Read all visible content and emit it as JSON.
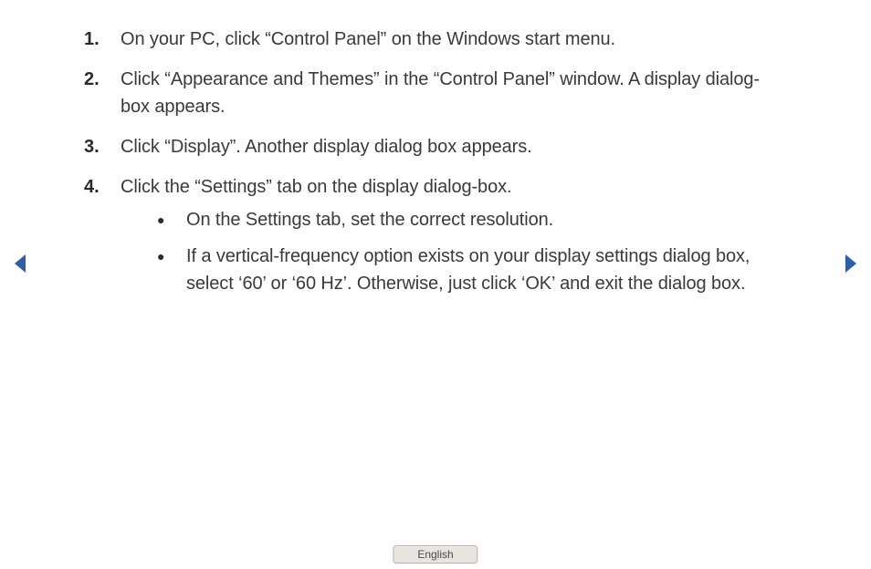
{
  "steps": [
    {
      "num": "1.",
      "text": "On your PC, click “Control Panel” on the Windows start menu."
    },
    {
      "num": "2.",
      "text": "Click “Appearance and Themes” in the “Control Panel” window. A display dialog-box appears."
    },
    {
      "num": "3.",
      "text": "Click “Display”. Another display dialog box appears."
    },
    {
      "num": "4.",
      "text": "Click the “Settings” tab on the display dialog-box.",
      "bullets": [
        "On the Settings tab, set the correct resolution.",
        "If a vertical-frequency option exists on your display settings dialog box, select ‘60’ or ‘60 Hz’. Otherwise, just click ‘OK’ and exit the dialog box."
      ]
    }
  ],
  "language_label": "English",
  "colors": {
    "nav_arrow": "#2c5fa8"
  }
}
